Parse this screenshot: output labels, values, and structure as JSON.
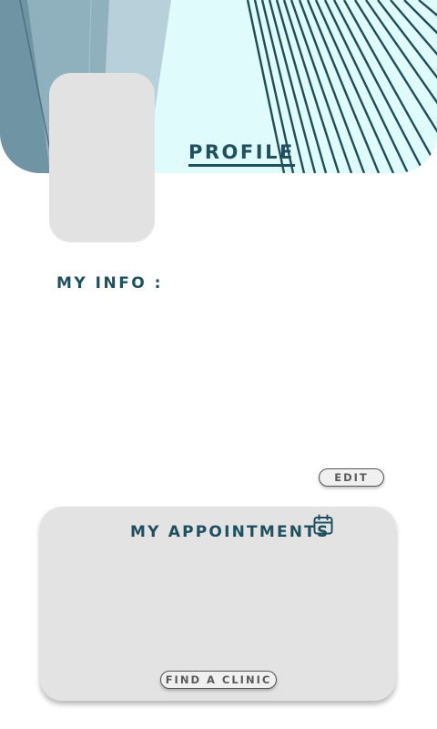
{
  "header": {
    "title": "PROFILE"
  },
  "profile": {
    "avatar_icon": "avatar-placeholder"
  },
  "info": {
    "label": "MY INFO :",
    "edit_label": "EDIT"
  },
  "appointments": {
    "title": "MY APPOINTMENTS",
    "title_icon": "calendar-icon",
    "find_clinic_label": "FIND A CLINIC"
  },
  "colors": {
    "accent": "#1e5060",
    "card_background": "#e3e3e3",
    "banner_background": "#e0fbfc"
  }
}
